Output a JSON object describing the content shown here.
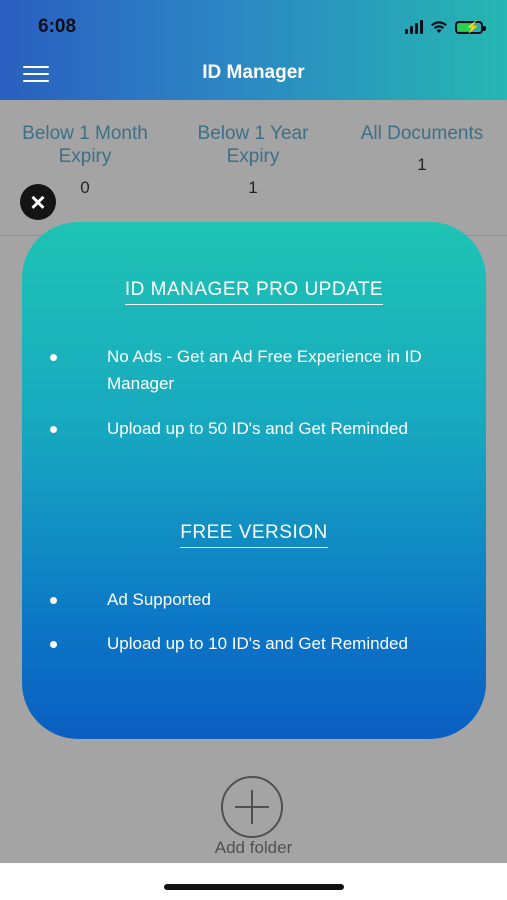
{
  "status_bar": {
    "time": "6:08"
  },
  "header": {
    "title": "ID Manager"
  },
  "stats": [
    {
      "label": "Below 1 Month Expiry",
      "count": "0"
    },
    {
      "label": "Below 1 Year Expiry",
      "count": "1"
    },
    {
      "label": "All Documents",
      "count": "1"
    }
  ],
  "modal": {
    "pro_title": "ID MANAGER PRO UPDATE",
    "pro_features": [
      "No Ads - Get an Ad Free Experience in ID Manager",
      "Upload up to 50 ID's and Get Reminded"
    ],
    "free_title": "FREE VERSION",
    "free_features": [
      "Ad Supported",
      "Upload up to 10 ID's and Get Reminded"
    ]
  },
  "add_folder": {
    "label": "Add folder"
  },
  "icons": {
    "menu": "hamburger-menu-icon",
    "close": "close-icon",
    "add": "plus-circle-icon"
  },
  "colors": {
    "header_start": "#2a5fc0",
    "header_end": "#25b7b1",
    "modal_top": "#1fc4b4",
    "modal_bottom": "#0b5ec2"
  }
}
